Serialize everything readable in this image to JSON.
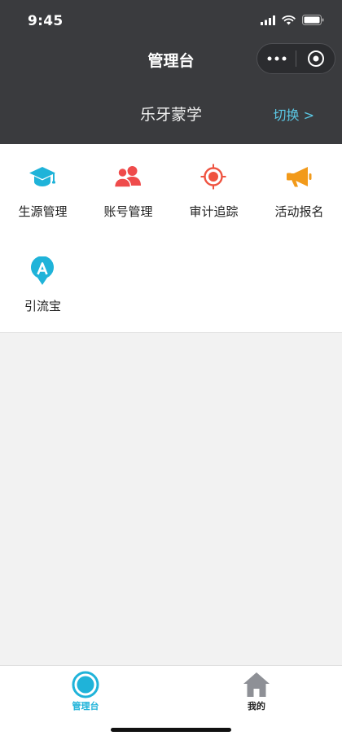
{
  "status_bar": {
    "time": "9:45"
  },
  "nav": {
    "title": "管理台"
  },
  "school": {
    "name": "乐牙蒙学",
    "switch_label": "切换 >"
  },
  "grid": {
    "items": [
      {
        "label": "生源管理",
        "icon": "graduation-cap-icon",
        "color": "#1fb3d9"
      },
      {
        "label": "账号管理",
        "icon": "users-icon",
        "color": "#ef4b4b"
      },
      {
        "label": "审计追踪",
        "icon": "target-icon",
        "color": "#ef5340"
      },
      {
        "label": "活动报名",
        "icon": "megaphone-icon",
        "color": "#f29a1a"
      },
      {
        "label": "引流宝",
        "icon": "location-pin-a-icon",
        "color": "#1fb3d9"
      }
    ]
  },
  "tabbar": {
    "tabs": [
      {
        "label": "管理台",
        "icon": "ring-icon",
        "active": true,
        "color": "#1fb3d9"
      },
      {
        "label": "我的",
        "icon": "home-icon",
        "active": false,
        "color": "#222222"
      }
    ]
  },
  "colors": {
    "header_bg": "#3a3b3e",
    "accent": "#1fb3d9",
    "switch_link": "#5bc9e6"
  }
}
